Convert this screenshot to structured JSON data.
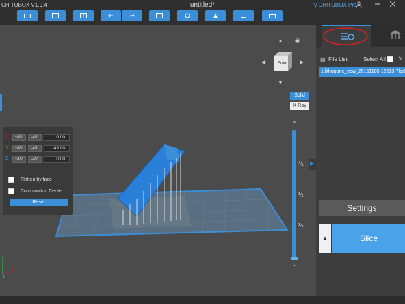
{
  "app": {
    "title": "CHITUBOX V1.9.4",
    "window_title": "untitled*",
    "try_pro": "Try CHITUBOX Pro"
  },
  "toolbar": {
    "buttons": [
      "open-icon",
      "save-icon",
      "import-icon",
      "undo-icon",
      "redo-icon",
      "auto-layout-icon",
      "support-icon",
      "hollow-icon",
      "print-icon"
    ]
  },
  "view_controls": {
    "cube_face": "Front",
    "cube_top": "top",
    "solid_label": "Solid",
    "xray_label": "X-Ray"
  },
  "rotate_panel": {
    "rows": [
      {
        "axis": "X",
        "plus": "+45°",
        "minus": "-45°",
        "value": "0.00"
      },
      {
        "axis": "Y",
        "plus": "+45°",
        "minus": "-45°",
        "value": "-43.00"
      },
      {
        "axis": "Z",
        "plus": "+45°",
        "minus": "-45°",
        "value": "0.00"
      }
    ],
    "flatten_label": "Flatten by face",
    "combination_label": "Combination Center",
    "reset_label": "Reset"
  },
  "slider": {
    "marks": [
      "¾",
      "½",
      "¼"
    ]
  },
  "right_panel": {
    "file_list_label": "File List:",
    "select_all_label": "Select All",
    "files": [
      "1.lithopane_new_20151105-16613-7kp1x"
    ],
    "settings_label": "Settings",
    "slice_label": "Slice",
    "slice_arrow": "▲"
  },
  "axes": {
    "x_label": "X",
    "y_label": "Y",
    "z_label": "Z"
  },
  "colors": {
    "accent": "#3b8fd9",
    "annotation": "#d92020"
  }
}
